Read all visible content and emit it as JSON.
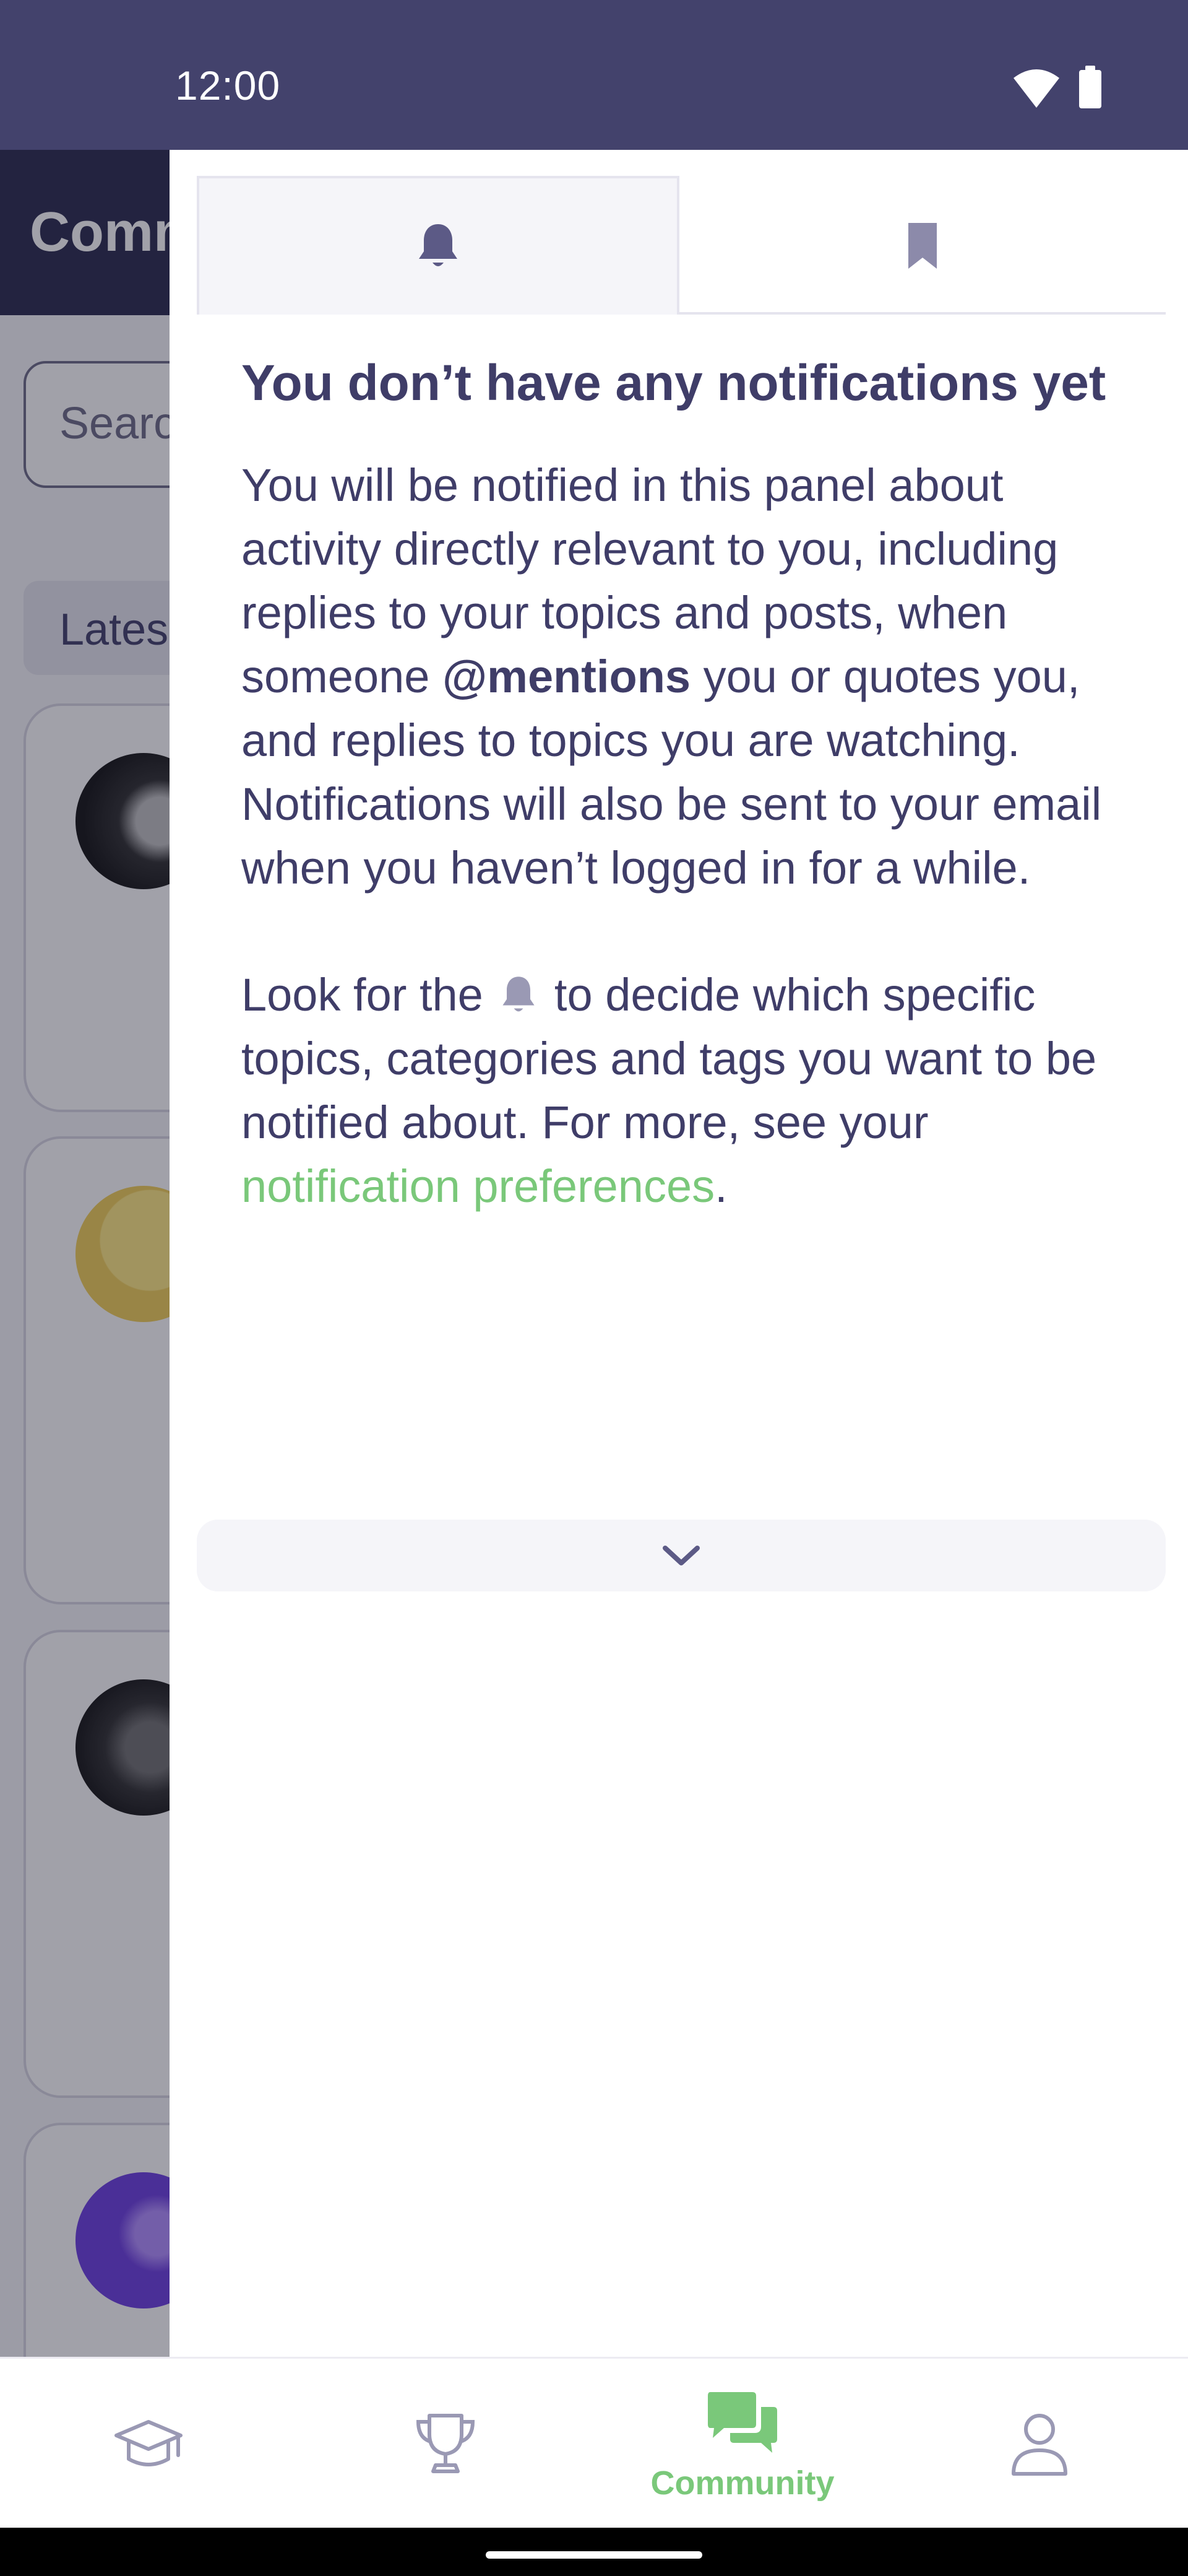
{
  "status_bar": {
    "time": "12:00"
  },
  "background_page": {
    "title": "Comm",
    "search_placeholder": "Searc",
    "filter_chip": "Lates"
  },
  "notifications_panel": {
    "tabs": [
      {
        "icon": "bell-icon",
        "selected": true
      },
      {
        "icon": "bookmark-icon",
        "selected": false
      }
    ],
    "empty_title": "You don’t have any notifications yet",
    "body1_before": "You will be notified in this panel about activity directly relevant to you, including replies to your topics and posts, when someone ",
    "body1_mentions": "@mentions",
    "body1_after": " you or quotes you, and replies to topics you are watching. Notifications will also be sent to your email when you haven’t logged in for a while.",
    "body2_before": "Look for the ",
    "body2_after": " to decide which specific topics, categories and tags you want to be notified about. For more, see your ",
    "preferences_link": "notification preferences",
    "body2_end": "."
  },
  "bottom_nav": {
    "items": [
      {
        "icon": "graduation-cap-icon",
        "label": ""
      },
      {
        "icon": "trophy-icon",
        "label": ""
      },
      {
        "icon": "chat-bubbles-icon",
        "label": "Community",
        "active": true
      },
      {
        "icon": "user-icon",
        "label": ""
      }
    ]
  },
  "colors": {
    "status_bar": "#43426c",
    "text": "#3f3d68",
    "accent_green": "#7ac87a",
    "icon_muted": "#9a99b4"
  }
}
